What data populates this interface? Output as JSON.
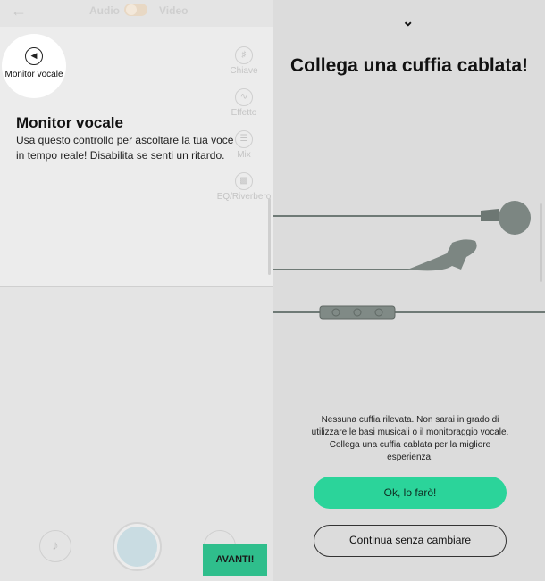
{
  "left_panel": {
    "mode_audio": "Audio",
    "mode_video": "Video",
    "spotlight_label": "Monitor vocale",
    "tools": [
      {
        "label": "Chiave",
        "icon": "key-icon"
      },
      {
        "label": "Effetto",
        "icon": "effect-wave-icon"
      },
      {
        "label": "Mix",
        "icon": "mixer-icon"
      },
      {
        "label": "EQ/Riverbero",
        "icon": "equalizer-icon"
      }
    ],
    "tip_title": "Monitor vocale",
    "tip_body": "Usa questo controllo per ascoltare la tua voce in tempo reale! Disabilita se senti un ritardo.",
    "next_button": "AVANTI!",
    "accent_color": "#2fbe8c"
  },
  "right_panel": {
    "title": "Collega una cuffia cablata!",
    "description": "Nessuna cuffia rilevata. Non sarai in grado di utilizzare le basi musicali o il monitoraggio vocale. Collega una cuffia cablata per la migliore esperienza.",
    "ok_button": "Ok, lo farò!",
    "continue_button": "Continua senza cambiare",
    "accent_color": "#2bd49a"
  }
}
